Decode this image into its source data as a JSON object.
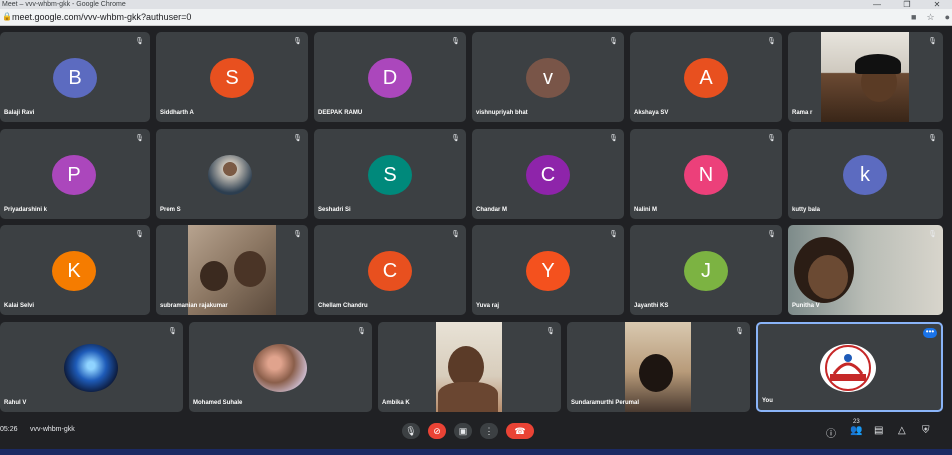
{
  "browser": {
    "title": "Meet – vvv-whbm-gkk - Google Chrome",
    "url": "meet.google.com/vvv-whbm-gkk?authuser=0",
    "window_controls": [
      "—",
      "❐",
      "✕"
    ]
  },
  "participants": [
    {
      "name": "Balaji Ravi",
      "initial": "B",
      "color": "#5c6bc0"
    },
    {
      "name": "Siddharth A",
      "initial": "S",
      "color": "#e8501f"
    },
    {
      "name": "DEEPAK RAMU",
      "initial": "D",
      "color": "#ab47bc"
    },
    {
      "name": "vishnupriyah bhat",
      "initial": "v",
      "color": "#795548"
    },
    {
      "name": "Akshaya SV",
      "initial": "A",
      "color": "#e8501f"
    },
    {
      "name": "Rama r",
      "initial": "",
      "color": "#3c4043"
    },
    {
      "name": "Priyadarshini k",
      "initial": "P",
      "color": "#ab47bc"
    },
    {
      "name": "Prem S",
      "initial": "",
      "color": "#3c4043"
    },
    {
      "name": "Seshadri Si",
      "initial": "S",
      "color": "#00897b"
    },
    {
      "name": "Chandar M",
      "initial": "C",
      "color": "#8e24aa"
    },
    {
      "name": "Nalini M",
      "initial": "N",
      "color": "#ec407a"
    },
    {
      "name": "kutty bala",
      "initial": "k",
      "color": "#5c6bc0"
    },
    {
      "name": "Kalai Selvi",
      "initial": "K",
      "color": "#f57c00"
    },
    {
      "name": "subramanian rajakumar",
      "initial": "",
      "color": "#3c4043"
    },
    {
      "name": "Chellam Chandru",
      "initial": "C",
      "color": "#e8501f"
    },
    {
      "name": "Yuva raj",
      "initial": "Y",
      "color": "#f4511e"
    },
    {
      "name": "Jayanthi KS",
      "initial": "J",
      "color": "#7cb342"
    },
    {
      "name": "Punitha V",
      "initial": "",
      "color": "#3c4043"
    },
    {
      "name": "Rahul V",
      "initial": "",
      "color": "#3c4043"
    },
    {
      "name": "Mohamed Suhale",
      "initial": "",
      "color": "#3c4043"
    },
    {
      "name": "Ambika K",
      "initial": "",
      "color": "#3c4043"
    },
    {
      "name": "Sundaramurthi Perumal",
      "initial": "",
      "color": "#3c4043"
    },
    {
      "name": "You",
      "initial": "",
      "color": "#3c4043"
    }
  ],
  "bottom": {
    "time": "05:26",
    "meeting_code": "vvv-whbm-gkk",
    "participants_count": "23"
  },
  "icons": {
    "mic": "mic-icon",
    "camera_off": "camera-off-icon",
    "present": "present-icon",
    "more": "more-icon",
    "hangup": "hangup-icon",
    "info": "info-icon",
    "people": "people-icon",
    "chat": "chat-icon",
    "activities": "activities-icon",
    "host": "host-controls-icon"
  },
  "colors": {
    "background": "#202124",
    "tile": "#3c4043",
    "hangup_red": "#ea4335",
    "you_border": "#8ab4f8"
  }
}
